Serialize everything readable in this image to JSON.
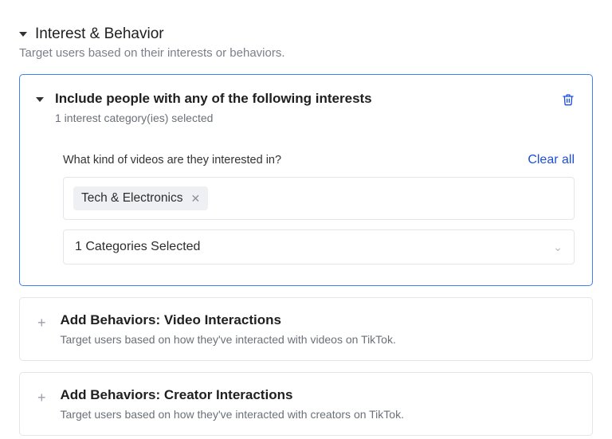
{
  "section": {
    "title": "Interest & Behavior",
    "description": "Target users based on their interests or behaviors."
  },
  "includePanel": {
    "title": "Include people with any of the following interests",
    "selectedSummary": "1 interest category(ies) selected",
    "question": "What kind of videos are they interested in?",
    "clearAll": "Clear all",
    "tags": [
      {
        "label": "Tech & Electronics"
      }
    ],
    "selectLabel": "1 Categories Selected"
  },
  "behaviors": [
    {
      "title": "Add Behaviors: Video Interactions",
      "sub": "Target users based on how they've interacted with videos on TikTok."
    },
    {
      "title": "Add Behaviors: Creator Interactions",
      "sub": "Target users based on how they've interacted with creators on TikTok."
    }
  ]
}
